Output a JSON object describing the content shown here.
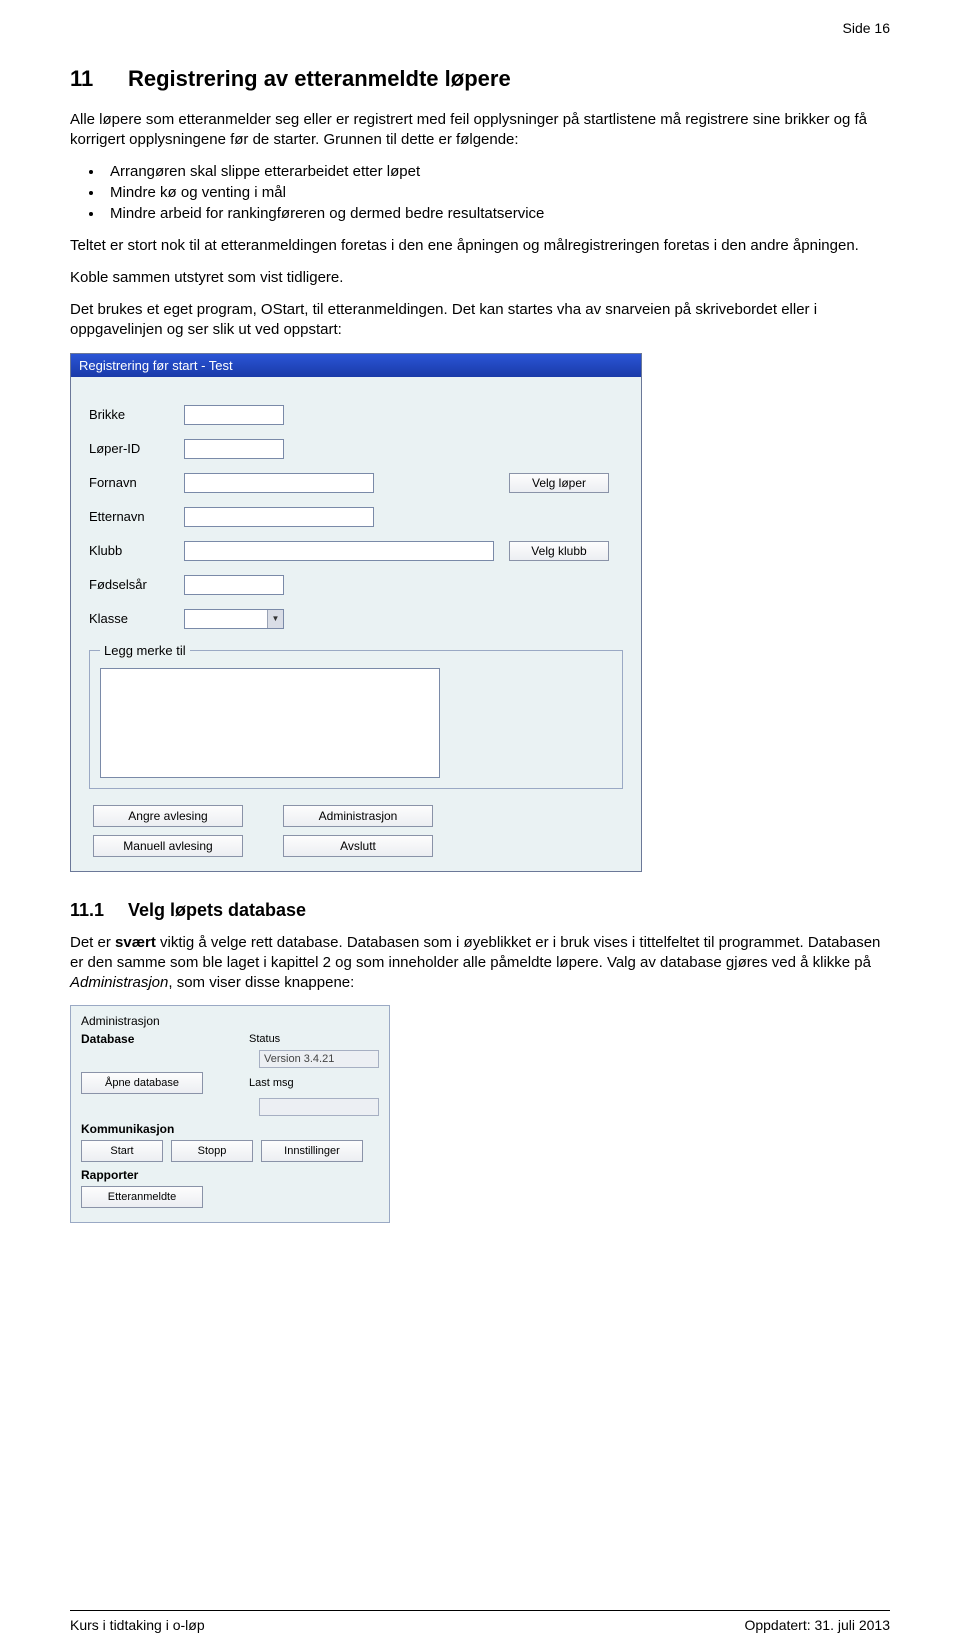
{
  "page_label": "Side 16",
  "section": {
    "num": "11",
    "title": "Registrering av etteranmeldte løpere"
  },
  "p1": "Alle løpere som etteranmelder seg eller er registrert med feil opplysninger på startlistene må registrere sine brikker og få korrigert opplysningene før de starter. Grunnen til dette er følgende:",
  "bullets": [
    "Arrangøren skal slippe etterarbeidet etter løpet",
    "Mindre kø og venting i mål",
    "Mindre arbeid for rankingføreren og dermed bedre resultatservice"
  ],
  "p2": "Teltet er stort nok til at etteranmeldingen foretas i den ene åpningen og målregistreringen foretas i den andre åpningen.",
  "p3": "Koble sammen utstyret som vist tidligere.",
  "p4": "Det brukes et eget program, OStart, til etteranmeldingen. Det kan startes vha av snarveien på skrivebordet eller i oppgavelinjen og ser slik ut ved oppstart:",
  "ss1": {
    "title": "Registrering før start - Test",
    "labels": {
      "brikke": "Brikke",
      "loperid": "Løper-ID",
      "fornavn": "Fornavn",
      "etternavn": "Etternavn",
      "klubb": "Klubb",
      "fodselsar": "Fødselsår",
      "klasse": "Klasse",
      "legg": "Legg merke til"
    },
    "btn_velg_loper": "Velg løper",
    "btn_velg_klubb": "Velg klubb",
    "btn_angre": "Angre avlesing",
    "btn_admin": "Administrasjon",
    "btn_manuell": "Manuell avlesing",
    "btn_avslutt": "Avslutt"
  },
  "sub": {
    "num": "11.1",
    "title": "Velg løpets database"
  },
  "p5a": "Det er ",
  "p5b": "svært",
  "p5c": " viktig å velge rett database. Databasen som i øyeblikket er i bruk vises i tittelfeltet til programmet. Databasen er den samme som ble laget i kapittel 2 og som inneholder alle påmeldte løpere. Valg av database gjøres ved å klikke på ",
  "p5d": "Administrasjon",
  "p5e": ", som viser disse knappene:",
  "ss2": {
    "hdr": "Administrasjon",
    "database": "Database",
    "status": "Status",
    "version": "Version 3.4.21",
    "open_db": "Åpne database",
    "last_msg": "Last msg",
    "komm": "Kommunikasjon",
    "start": "Start",
    "stopp": "Stopp",
    "innst": "Innstillinger",
    "rapporter": "Rapporter",
    "etteranm": "Etteranmeldte"
  },
  "footer_left": "Kurs i tidtaking i o-løp",
  "footer_right": "Oppdatert: 31. juli 2013"
}
